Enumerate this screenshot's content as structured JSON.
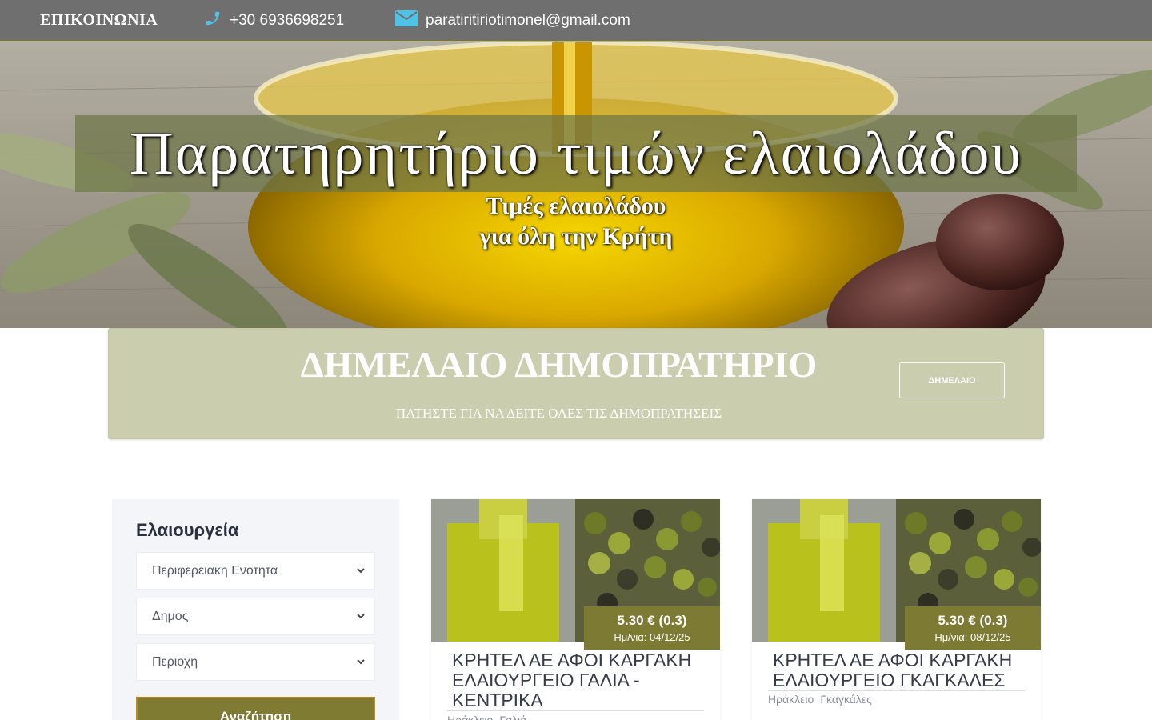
{
  "topbar": {
    "contact_label": "ΕΠΙΚΟΙΝΩΝΙΑ",
    "phone": "+30 6936698251",
    "email": "paratiritiriotimonel@gmail.com",
    "phone_icon": "phone-icon",
    "email_icon": "envelope-icon"
  },
  "hero": {
    "title": "Παρατηρητήριο τιμών ελαιολάδου",
    "subtitle_line1": "Τιμές ελαιολάδου",
    "subtitle_line2": "για όλη την Κρήτη"
  },
  "auction": {
    "title": "ΔΗΜΕΛΑΙΟ ΔΗΜΟΠΡΑΤΗΡΙΟ",
    "subtitle": "ΠΑΤΗΣΤΕ ΓΙΑ ΝΑ ΔΕΙΤΕ ΟΛΕΣ ΤΙΣ ΔΗΜΟΠΡΑΤΗΣΕΙΣ",
    "button_label": "ΔΗΜΕΛΑΙΟ"
  },
  "sidebar": {
    "title": "Ελαιουργεία",
    "selects": [
      {
        "value": "Περιφερειακη Ενοτητα"
      },
      {
        "value": "Δημος"
      },
      {
        "value": "Περιοχη"
      }
    ],
    "search_label": "Αναζήτηση"
  },
  "cards": [
    {
      "price": "5.30 € (0.3)",
      "date": "Ημ/νια: 04/12/25",
      "name": "ΚΡΗΤΕΛ ΑΕ ΑΦΟΙ ΚΑΡΓΑΚΗ ΕΛΑΙΟΥΡΓΕΙΟ ΓΑΛΙΑ - ΚΕΝΤΡΙΚΑ",
      "region": "Ηράκλειο",
      "area": "Γαλιά"
    },
    {
      "price": "5.30 € (0.3)",
      "date": "Ημ/νια: 08/12/25",
      "name": "ΚΡΗΤΕΛ ΑΕ ΑΦΟΙ ΚΑΡΓΑΚΗ ΕΛΑΙΟΥΡΓΕΙΟ ΓΚΑΓΚΑΛΕΣ",
      "region": "Ηράκλειο",
      "area": "Γκαγκάλες"
    }
  ],
  "colors": {
    "topbar": "#6f6f6f",
    "olive_accent": "#7d7a34",
    "auction_bg": "#cbcdaf"
  }
}
